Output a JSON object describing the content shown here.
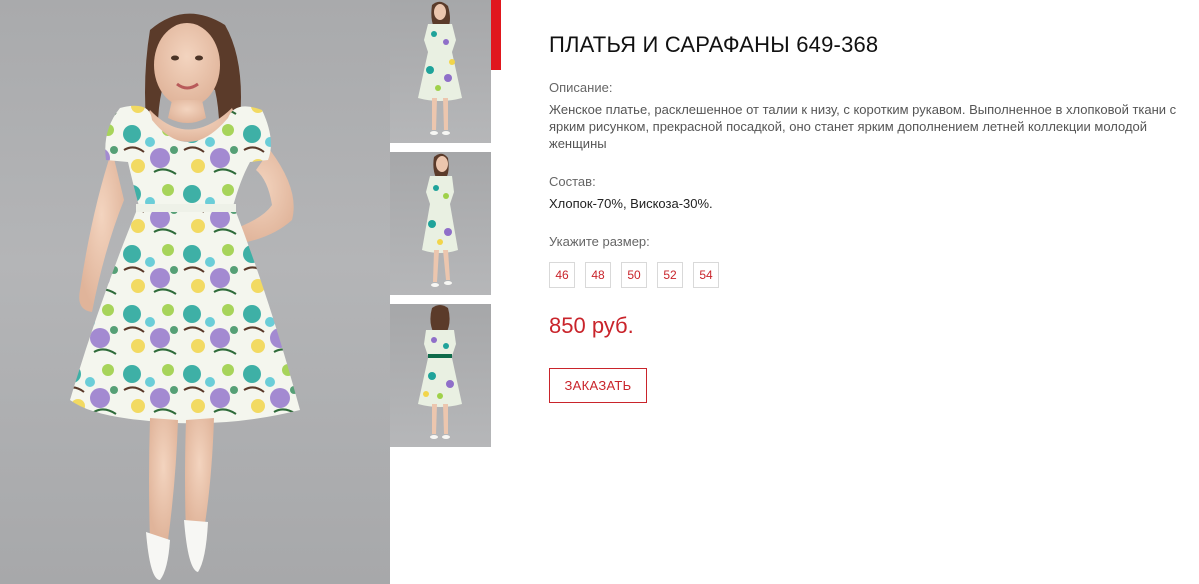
{
  "product": {
    "title": "ПЛАТЬЯ И САРАФАНЫ 649-368",
    "description_label": "Описание:",
    "description": "Женское платье, расклешенное от талии к низу, с коротким рукавом. Выполненное в хлопковой ткани с ярким рисунком, прекрасной посадкой, оно станет ярким дополнением летней коллекции молодой женщины",
    "composition_label": "Состав:",
    "composition": "Хлопок-70%, Вискоза-30%.",
    "size_label": "Укажите размер:",
    "sizes": [
      "46",
      "48",
      "50",
      "52",
      "54"
    ],
    "price": "850 руб.",
    "order_button": "ЗАКАЗАТЬ"
  },
  "colors": {
    "accent": "#c9242b",
    "active_marker": "#e0171e",
    "photo_background": "#adaeb0"
  },
  "gallery": {
    "main_photo": "model-front-photo",
    "thumbnails": [
      "model-front-thumb",
      "model-three-quarter-thumb",
      "model-back-thumb"
    ],
    "active_index": 0
  }
}
